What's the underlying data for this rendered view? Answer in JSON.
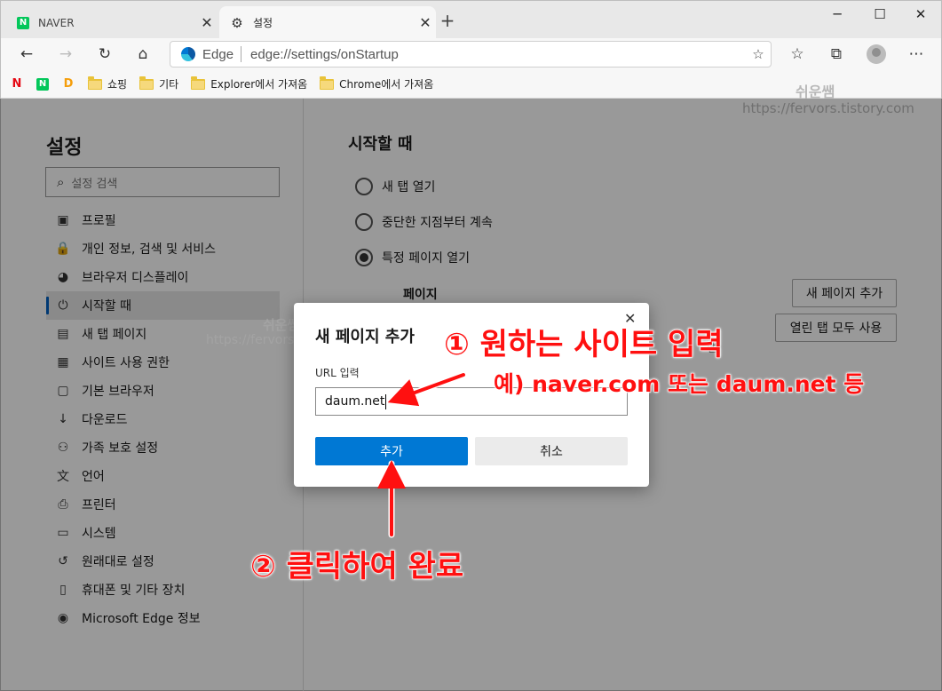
{
  "tabs": [
    {
      "label": "NAVER",
      "icon": "naver-icon",
      "active": false
    },
    {
      "label": "설정",
      "icon": "gear-icon",
      "active": true
    }
  ],
  "address": {
    "browser": "Edge",
    "url": "edge://settings/onStartup"
  },
  "bookmarks": [
    {
      "label": "",
      "icon": "netflix-icon",
      "glyph": "N",
      "color": "#e50914"
    },
    {
      "label": "",
      "icon": "naver-icon",
      "glyph": "N",
      "color": "#03c75a"
    },
    {
      "label": "",
      "icon": "daum-icon",
      "glyph": "D",
      "color": "#f59e0b"
    },
    {
      "label": "쇼핑",
      "icon": "folder-icon"
    },
    {
      "label": "기타",
      "icon": "folder-icon"
    },
    {
      "label": "Explorer에서 가져옴",
      "icon": "folder-icon"
    },
    {
      "label": "Chrome에서 가져옴",
      "icon": "folder-icon"
    }
  ],
  "watermark": {
    "name": "쉬운쌤",
    "url": "https://fervors.tistory.com"
  },
  "watermark_dim": {
    "name": "쉬운쌤",
    "url": "https://fervors.tistory.com"
  },
  "sidebar": {
    "title": "설정",
    "search_placeholder": "설정 검색",
    "items": [
      {
        "label": "프로필",
        "icon": "profile-icon",
        "glyph": "▣"
      },
      {
        "label": "개인 정보, 검색 및 서비스",
        "icon": "lock-icon",
        "glyph": "🔒"
      },
      {
        "label": "브라우저 디스플레이",
        "icon": "palette-icon",
        "glyph": "◕"
      },
      {
        "label": "시작할 때",
        "icon": "power-icon",
        "glyph": "⏻",
        "selected": true
      },
      {
        "label": "새 탭 페이지",
        "icon": "newtab-icon",
        "glyph": "▤"
      },
      {
        "label": "사이트 사용 권한",
        "icon": "site-permission-icon",
        "glyph": "▦"
      },
      {
        "label": "기본 브라우저",
        "icon": "default-browser-icon",
        "glyph": "▢"
      },
      {
        "label": "다운로드",
        "icon": "download-icon",
        "glyph": "↓"
      },
      {
        "label": "가족 보호 설정",
        "icon": "family-icon",
        "glyph": "⚇"
      },
      {
        "label": "언어",
        "icon": "language-icon",
        "glyph": "文"
      },
      {
        "label": "프린터",
        "icon": "printer-icon",
        "glyph": "⎙"
      },
      {
        "label": "시스템",
        "icon": "system-icon",
        "glyph": "▭"
      },
      {
        "label": "원래대로 설정",
        "icon": "reset-icon",
        "glyph": "↺"
      },
      {
        "label": "휴대폰 및 기타 장치",
        "icon": "phone-icon",
        "glyph": "▯"
      },
      {
        "label": "Microsoft Edge 정보",
        "icon": "edge-icon",
        "glyph": "◉"
      }
    ]
  },
  "main": {
    "title": "시작할 때",
    "options": [
      {
        "label": "새 탭 열기",
        "checked": false
      },
      {
        "label": "중단한 지점부터 계속",
        "checked": false
      },
      {
        "label": "특정 페이지 열기",
        "checked": true
      }
    ],
    "pages_label": "페이지",
    "add_page_button": "새 페이지 추가",
    "use_open_tabs_button": "열린 탭 모두 사용",
    "partial_text": "탭"
  },
  "dialog": {
    "title": "새 페이지 추가",
    "url_label": "URL 입력",
    "url_value": "daum.net",
    "add_button": "추가",
    "cancel_button": "취소"
  },
  "annotations": {
    "step1": "① 원하는 사이트 입력",
    "step1_example": "예) naver.com 또는 daum.net 등",
    "step2": "② 클릭하여 완료"
  },
  "colors": {
    "accent": "#0078d4",
    "annotation": "#ff1010"
  }
}
